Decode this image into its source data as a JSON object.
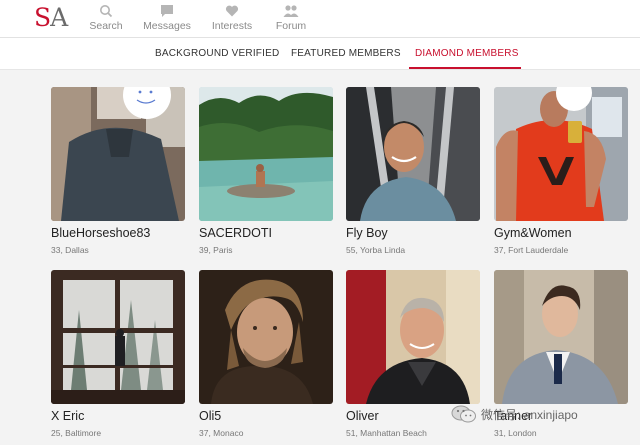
{
  "header": {
    "logo_s": "S",
    "logo_a": "A",
    "nav": [
      {
        "label": "Search",
        "icon": "search-icon"
      },
      {
        "label": "Messages",
        "icon": "message-icon"
      },
      {
        "label": "Interests",
        "icon": "heart-icon"
      },
      {
        "label": "Forum",
        "icon": "forum-icon"
      }
    ]
  },
  "tabs": [
    {
      "label": "BACKGROUND VERIFIED",
      "active": false
    },
    {
      "label": "FEATURED MEMBERS",
      "active": false
    },
    {
      "label": "DIAMOND MEMBERS",
      "active": true
    }
  ],
  "accent_color": "#c8102e",
  "members": [
    {
      "name": "BlueHorseshoe83",
      "details": "33, Dallas"
    },
    {
      "name": "SACERDOTI",
      "details": "39, Paris"
    },
    {
      "name": "Fly Boy",
      "details": "55, Yorba Linda"
    },
    {
      "name": "Gym&Women",
      "details": "37, Fort Lauderdale"
    },
    {
      "name": "X Eric",
      "details": "25, Baltimore"
    },
    {
      "name": "Oli5",
      "details": "37, Monaco"
    },
    {
      "name": "Oliver",
      "details": "51, Manhattan Beach"
    },
    {
      "name": "Tanner",
      "details": "31, London"
    }
  ],
  "watermark": {
    "text": "微信号: anxinjiapo"
  }
}
